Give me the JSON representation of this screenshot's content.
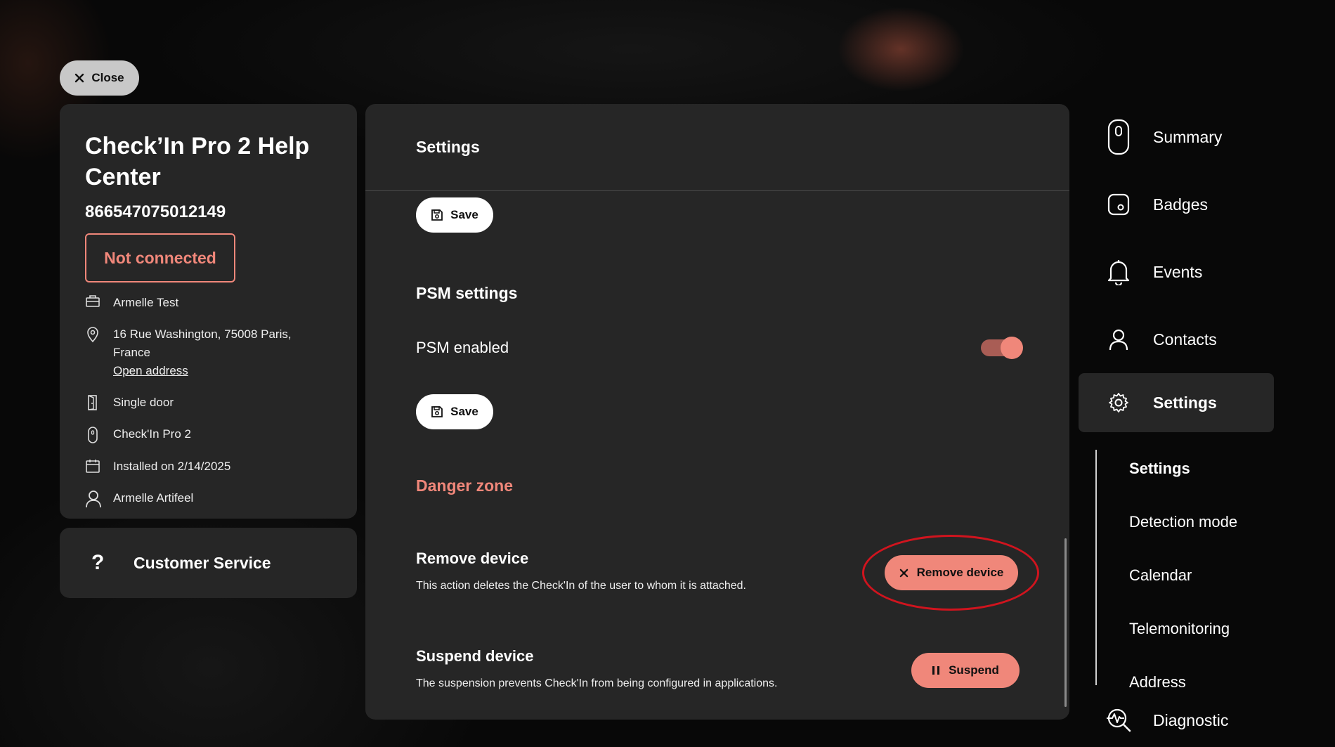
{
  "close_label": "Close",
  "device": {
    "title": "Check’In Pro 2 Help Center",
    "serial": "866547075012149",
    "status": "Not connected",
    "status_color": "#f0877a",
    "company": "Armelle Test",
    "address": "16 Rue Washington, 75008 Paris, France",
    "open_address_label": "Open address",
    "door_type": "Single door",
    "model": "Check'In Pro 2",
    "installed": "Installed on 2/14/2025",
    "owner": "Armelle Artifeel"
  },
  "customer_service_label": "Customer Service",
  "main": {
    "header": "Settings",
    "save_label": "Save",
    "psm_title": "PSM settings",
    "psm_label": "PSM enabled",
    "psm_enabled": true,
    "danger_title": "Danger zone",
    "remove": {
      "title": "Remove device",
      "description": "This action deletes the Check'In of the user to whom it is attached.",
      "button": "Remove device"
    },
    "suspend": {
      "title": "Suspend device",
      "description": "The suspension prevents Check'In from being configured in applications.",
      "button": "Suspend"
    }
  },
  "nav": {
    "items": [
      {
        "label": "Summary",
        "icon": "device-icon"
      },
      {
        "label": "Badges",
        "icon": "badge-icon"
      },
      {
        "label": "Events",
        "icon": "bell-icon"
      },
      {
        "label": "Contacts",
        "icon": "person-icon"
      },
      {
        "label": "Settings",
        "icon": "gear-icon",
        "active": true
      },
      {
        "label": "Diagnostic",
        "icon": "diagnostic-icon"
      }
    ],
    "sub_items": [
      "Settings",
      "Detection mode",
      "Calendar",
      "Telemonitoring",
      "Address"
    ]
  },
  "colors": {
    "accent": "#f0877a",
    "panel": "#262626",
    "highlight_ring": "#d0141e"
  }
}
